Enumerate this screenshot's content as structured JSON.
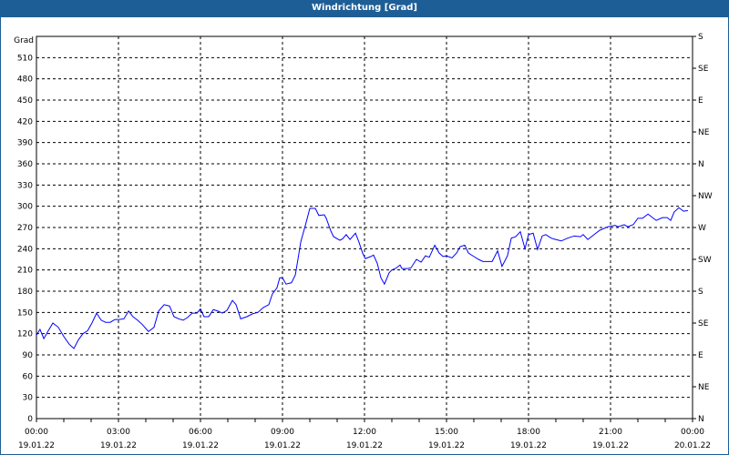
{
  "window": {
    "title": "Windrichtung [Grad]"
  },
  "chart_data": {
    "type": "line",
    "title": "Windrichtung [Grad]",
    "ylabel": "Grad",
    "xlabel": "",
    "ylim": [
      0,
      540
    ],
    "xlim_hours": [
      0,
      24
    ],
    "grid": true,
    "y_ticks": [
      0,
      30,
      60,
      90,
      120,
      150,
      180,
      210,
      240,
      270,
      300,
      330,
      360,
      390,
      420,
      450,
      480,
      510
    ],
    "right_axis_ticks": [
      {
        "value": 0,
        "label": "N"
      },
      {
        "value": 45,
        "label": "NE"
      },
      {
        "value": 90,
        "label": "E"
      },
      {
        "value": 135,
        "label": "SE"
      },
      {
        "value": 180,
        "label": "S"
      },
      {
        "value": 225,
        "label": "SW"
      },
      {
        "value": 270,
        "label": "W"
      },
      {
        "value": 315,
        "label": "NW"
      },
      {
        "value": 360,
        "label": "N"
      },
      {
        "value": 405,
        "label": "NE"
      },
      {
        "value": 450,
        "label": "E"
      },
      {
        "value": 495,
        "label": "SE"
      },
      {
        "value": 540,
        "label": "S"
      }
    ],
    "x_ticks": [
      {
        "hour": 0,
        "time": "00:00",
        "date": "19.01.22"
      },
      {
        "hour": 3,
        "time": "03:00",
        "date": "19.01.22"
      },
      {
        "hour": 6,
        "time": "06:00",
        "date": "19.01.22"
      },
      {
        "hour": 9,
        "time": "09:00",
        "date": "19.01.22"
      },
      {
        "hour": 12,
        "time": "12:00",
        "date": "19.01.22"
      },
      {
        "hour": 15,
        "time": "15:00",
        "date": "19.01.22"
      },
      {
        "hour": 18,
        "time": "18:00",
        "date": "19.01.22"
      },
      {
        "hour": 21,
        "time": "21:00",
        "date": "19.01.22"
      },
      {
        "hour": 24,
        "time": "00:00",
        "date": "20.01.22"
      }
    ],
    "series": [
      {
        "name": "Windrichtung",
        "color": "#0000ff",
        "points": [
          [
            0,
            118
          ],
          [
            0.13,
            126
          ],
          [
            0.27,
            113
          ],
          [
            0.4,
            122
          ],
          [
            0.6,
            135
          ],
          [
            0.8,
            129
          ],
          [
            1,
            116
          ],
          [
            1.2,
            105
          ],
          [
            1.37,
            99
          ],
          [
            1.53,
            111
          ],
          [
            1.7,
            120
          ],
          [
            1.87,
            124
          ],
          [
            2.03,
            135
          ],
          [
            2.2,
            149
          ],
          [
            2.37,
            139
          ],
          [
            2.53,
            136
          ],
          [
            2.7,
            136
          ],
          [
            2.87,
            140
          ],
          [
            3.03,
            140
          ],
          [
            3.2,
            141
          ],
          [
            3.37,
            152
          ],
          [
            3.53,
            144
          ],
          [
            3.7,
            139
          ],
          [
            3.87,
            133
          ],
          [
            4.03,
            126
          ],
          [
            4.1,
            123
          ],
          [
            4.3,
            129
          ],
          [
            4.47,
            152
          ],
          [
            4.67,
            161
          ],
          [
            4.87,
            159
          ],
          [
            5.03,
            144
          ],
          [
            5.2,
            141
          ],
          [
            5.37,
            139
          ],
          [
            5.53,
            143
          ],
          [
            5.7,
            149
          ],
          [
            5.87,
            149
          ],
          [
            6,
            155
          ],
          [
            6.13,
            144
          ],
          [
            6.3,
            144
          ],
          [
            6.47,
            154
          ],
          [
            6.63,
            152
          ],
          [
            6.8,
            149
          ],
          [
            6.97,
            153
          ],
          [
            7.17,
            167
          ],
          [
            7.3,
            161
          ],
          [
            7.47,
            141
          ],
          [
            7.7,
            144
          ],
          [
            7.9,
            148
          ],
          [
            8.1,
            150
          ],
          [
            8.3,
            157
          ],
          [
            8.5,
            161
          ],
          [
            8.63,
            176
          ],
          [
            8.8,
            185
          ],
          [
            8.9,
            199
          ],
          [
            9,
            199
          ],
          [
            9.13,
            190
          ],
          [
            9.33,
            192
          ],
          [
            9.47,
            203
          ],
          [
            9.57,
            226
          ],
          [
            9.67,
            250
          ],
          [
            9.83,
            272
          ],
          [
            10,
            297
          ],
          [
            10.2,
            297
          ],
          [
            10.33,
            287
          ],
          [
            10.53,
            288
          ],
          [
            10.6,
            283
          ],
          [
            10.77,
            265
          ],
          [
            10.87,
            257
          ],
          [
            11.1,
            252
          ],
          [
            11.2,
            254
          ],
          [
            11.33,
            260
          ],
          [
            11.47,
            253
          ],
          [
            11.67,
            262
          ],
          [
            11.8,
            249
          ],
          [
            11.93,
            234
          ],
          [
            12.03,
            226
          ],
          [
            12.23,
            229
          ],
          [
            12.33,
            231
          ],
          [
            12.47,
            219
          ],
          [
            12.6,
            199
          ],
          [
            12.73,
            190
          ],
          [
            12.9,
            206
          ],
          [
            13,
            210
          ],
          [
            13.13,
            212
          ],
          [
            13.3,
            217
          ],
          [
            13.37,
            212
          ],
          [
            13.57,
            212
          ],
          [
            13.7,
            213
          ],
          [
            13.9,
            225
          ],
          [
            14.07,
            221
          ],
          [
            14.23,
            230
          ],
          [
            14.37,
            228
          ],
          [
            14.57,
            245
          ],
          [
            14.73,
            234
          ],
          [
            14.87,
            229
          ],
          [
            15,
            230
          ],
          [
            15.2,
            227
          ],
          [
            15.37,
            234
          ],
          [
            15.5,
            243
          ],
          [
            15.67,
            245
          ],
          [
            15.8,
            234
          ],
          [
            16,
            229
          ],
          [
            16.17,
            225
          ],
          [
            16.33,
            222
          ],
          [
            16.67,
            222
          ],
          [
            16.87,
            237
          ],
          [
            17.03,
            215
          ],
          [
            17.23,
            230
          ],
          [
            17.37,
            255
          ],
          [
            17.53,
            257
          ],
          [
            17.7,
            264
          ],
          [
            17.87,
            240
          ],
          [
            18,
            260
          ],
          [
            18.17,
            262
          ],
          [
            18.33,
            239
          ],
          [
            18.5,
            258
          ],
          [
            18.63,
            260
          ],
          [
            18.83,
            255
          ],
          [
            19,
            253
          ],
          [
            19.2,
            251
          ],
          [
            19.43,
            255
          ],
          [
            19.67,
            258
          ],
          [
            19.9,
            257
          ],
          [
            20,
            260
          ],
          [
            20.17,
            253
          ],
          [
            20.4,
            260
          ],
          [
            20.6,
            266
          ],
          [
            20.9,
            271
          ],
          [
            21.17,
            273
          ],
          [
            21.27,
            271
          ],
          [
            21.5,
            274
          ],
          [
            21.63,
            271
          ],
          [
            21.83,
            274
          ],
          [
            22,
            283
          ],
          [
            22.17,
            283
          ],
          [
            22.37,
            289
          ],
          [
            22.67,
            280
          ],
          [
            22.9,
            284
          ],
          [
            23.07,
            284
          ],
          [
            23.2,
            280
          ],
          [
            23.33,
            292
          ],
          [
            23.5,
            298
          ],
          [
            23.67,
            293
          ],
          [
            23.83,
            294
          ]
        ]
      }
    ]
  }
}
